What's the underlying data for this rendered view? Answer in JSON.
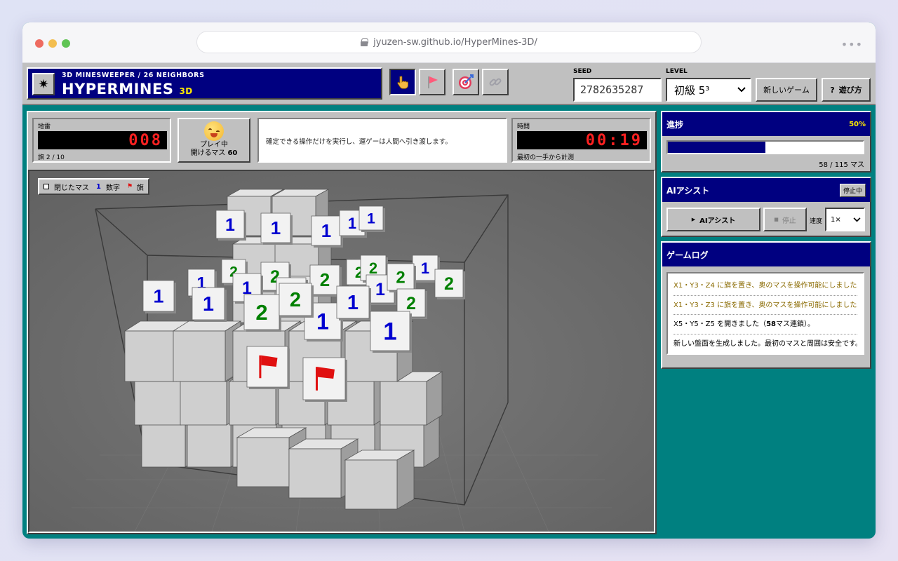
{
  "browser": {
    "url": "jyuzen-sw.github.io/HyperMines-3D/"
  },
  "header": {
    "subtitle": "3D MINESWEEPER / 26 NEIGHBORS",
    "title": "HYPERMINES",
    "title_suffix": "3D",
    "seed_label": "SEED",
    "seed_value": "2782635287",
    "level_label": "LEVEL",
    "level_value": "初級 5³",
    "new_game_label": "新しいゲーム",
    "help_label": "遊び方",
    "help_mark": "?"
  },
  "status": {
    "mines_label": "地雷",
    "mines_value": "008",
    "flags_note": "旗 2 / 10",
    "face_status": "プレイ中",
    "openable_label": "開けるマス",
    "openable_value": "60",
    "message": "確定できる操作だけを実行し、運ゲーは人間へ引き渡します。",
    "time_label": "時間",
    "time_value": "00:19",
    "time_note": "最初の一手から計測"
  },
  "legend": {
    "closed": "閉じたマス",
    "number_mark": "1",
    "number": "数字",
    "flag": "旗"
  },
  "progress": {
    "title": "進捗",
    "percent_label": "50%",
    "percent": 50,
    "opened": "58",
    "total": "115",
    "unit": "マス"
  },
  "assist": {
    "title": "AIアシスト",
    "status": "停止中",
    "run_label": "AIアシスト",
    "stop_label": "停止",
    "speed_label": "速度",
    "speed_value": "1×"
  },
  "log": {
    "title": "ゲームログ",
    "entries": [
      {
        "coord": "X1・Y3・Z4",
        "text": "に旗を置き、奥のマスを操作可能にしました。"
      },
      {
        "coord": "X1・Y3・Z3",
        "text": "に旗を置き、奥のマスを操作可能にしました。"
      },
      {
        "coord": "X5・Y5・Z5",
        "text": "を開きました（",
        "count": "58",
        "text2": "マス連鎖）。"
      },
      {
        "text": "新しい盤面を生成しました。最初のマスと周囲は安全です。"
      }
    ]
  },
  "colors": {
    "accent": "#000080",
    "background": "#008080",
    "lcd_red": "#ff2020",
    "number_1": "#0000d0",
    "number_2": "#008000",
    "flag": "#e01010"
  },
  "board_labels": {
    "one": "1",
    "two": "2"
  },
  "board": {
    "number_tiles": [
      {
        "value": 1,
        "color": "#0000d0"
      },
      {
        "value": 1,
        "color": "#0000d0"
      },
      {
        "value": 1,
        "color": "#0000d0"
      },
      {
        "value": 1,
        "color": "#0000d0"
      },
      {
        "value": 1,
        "color": "#0000d0"
      },
      {
        "value": 2,
        "color": "#008000"
      },
      {
        "value": 2,
        "color": "#008000"
      },
      {
        "value": 2,
        "color": "#008000"
      },
      {
        "value": 2,
        "color": "#008000"
      },
      {
        "value": 2,
        "color": "#008000"
      },
      {
        "value": 1,
        "color": "#0000d0"
      },
      {
        "value": 1,
        "color": "#0000d0"
      },
      {
        "value": 1,
        "color": "#0000d0"
      },
      {
        "value": 1,
        "color": "#0000d0"
      },
      {
        "value": 1,
        "color": "#0000d0"
      },
      {
        "value": 2,
        "color": "#008000"
      },
      {
        "value": 2,
        "color": "#008000"
      },
      {
        "value": 2,
        "color": "#008000"
      },
      {
        "value": 1,
        "color": "#0000d0"
      },
      {
        "value": 1,
        "color": "#0000d0"
      },
      {
        "value": 1,
        "color": "#0000d0"
      },
      {
        "value": 2,
        "color": "#008000"
      },
      {
        "value": 2,
        "color": "#008000"
      },
      {
        "value": 1,
        "color": "#0000d0"
      },
      {
        "value": 1,
        "color": "#0000d0"
      }
    ],
    "flags": 2
  }
}
